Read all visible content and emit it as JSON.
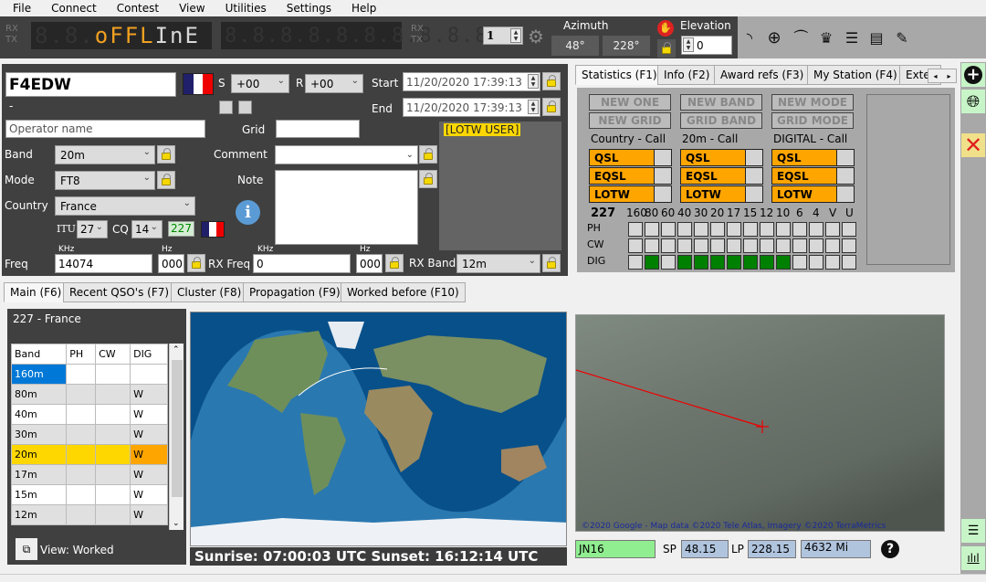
{
  "menu": [
    "File",
    "Connect",
    "Contest",
    "View",
    "Utilities",
    "Settings",
    "Help"
  ],
  "radio_display": {
    "rx_label": "RX",
    "tx_label": "TX",
    "status_text_orange": "oFFL",
    "status_text_white": "InE",
    "dim_left": "8.8.",
    "dim_right": "8.8.8.8.8.8.8.8.8.8."
  },
  "rotator": {
    "rig_number": "1",
    "azimuth_label": "Azimuth",
    "short_path": "48°",
    "long_path": "228°",
    "elevation_label": "Elevation",
    "elevation_value": "0"
  },
  "toolbar_icons": [
    "signal-icon",
    "globe-icon",
    "satellite-dish-icon",
    "crown-icon",
    "server-icon",
    "radio-icon",
    "microphone-icon"
  ],
  "qso": {
    "callsign": "F4EDW",
    "name_placeholder": "Operator name",
    "dash": "-",
    "rst_sent_label": "S",
    "rst_sent": "+00",
    "rst_rcvd_label": "R",
    "rst_rcvd": "+00",
    "start_label": "Start",
    "start_value": "11/20/2020 17:39:13",
    "end_label": "End",
    "end_value": "11/20/2020 17:39:13",
    "grid_label": "Grid",
    "grid_value": "",
    "band_label": "Band",
    "band_value": "20m",
    "mode_label": "Mode",
    "mode_value": "FT8",
    "country_label": "Country",
    "country_value": "France",
    "comment_label": "Comment",
    "comment_value": "",
    "note_label": "Note",
    "note_value": "",
    "itu_label": "ITU",
    "itu_value": "27",
    "cq_label": "CQ",
    "cq_value": "14",
    "dxcc": "227",
    "lotw_badge": "[LOTW USER]",
    "khz_label": "KHz",
    "hz_label": "Hz",
    "freq_label": "Freq",
    "freq_khz": "14074",
    "freq_hz": "000",
    "rxfreq_label": "RX Freq",
    "rxfreq_khz": "0",
    "rxfreq_hz": "000",
    "rxband_label": "RX Band",
    "rxband_value": "12m"
  },
  "stats_tabs": [
    "Statistics (F1)",
    "Info (F2)",
    "Award refs (F3)",
    "My Station (F4)",
    "Exte"
  ],
  "stats": {
    "new_buttons": [
      "NEW ONE",
      "NEW BAND",
      "NEW MODE",
      "NEW GRID",
      "GRID BAND",
      "GRID MODE"
    ],
    "columns": [
      "Country - Call",
      "20m - Call",
      "DIGITAL - Call"
    ],
    "qsl_labels": [
      "QSL",
      "EQSL",
      "LOTW"
    ],
    "dxcc": "227",
    "bands": [
      "160",
      "80",
      "60",
      "40",
      "30",
      "20",
      "17",
      "15",
      "12",
      "10",
      "6",
      "4",
      "V",
      "U"
    ],
    "modes": [
      "PH",
      "CW",
      "DIG"
    ],
    "worked": {
      "PH": [
        0,
        0,
        0,
        0,
        0,
        0,
        0,
        0,
        0,
        0,
        0,
        0,
        0,
        0
      ],
      "CW": [
        0,
        0,
        0,
        0,
        0,
        0,
        0,
        0,
        0,
        0,
        0,
        0,
        0,
        0
      ],
      "DIG": [
        0,
        1,
        0,
        1,
        1,
        1,
        1,
        1,
        1,
        1,
        0,
        0,
        0,
        0
      ]
    },
    "colors": {
      "worked": "#008000",
      "empty": "#d8d8d8",
      "qsl": "#ffa500"
    }
  },
  "main_tabs": [
    "Main (F6)",
    "Recent QSO's (F7)",
    "Cluster (F8)",
    "Propagation (F9)",
    "Worked before (F10)"
  ],
  "worked_panel": {
    "title": "227 - France",
    "headers": [
      "Band",
      "PH",
      "CW",
      "DIG"
    ],
    "rows": [
      {
        "band": "160m",
        "PH": "",
        "CW": "",
        "DIG": ""
      },
      {
        "band": "80m",
        "PH": "",
        "CW": "",
        "DIG": "W"
      },
      {
        "band": "40m",
        "PH": "",
        "CW": "",
        "DIG": "W"
      },
      {
        "band": "30m",
        "PH": "",
        "CW": "",
        "DIG": "W"
      },
      {
        "band": "20m",
        "PH": "",
        "CW": "",
        "DIG": "W"
      },
      {
        "band": "17m",
        "PH": "",
        "CW": "",
        "DIG": "W"
      },
      {
        "band": "15m",
        "PH": "",
        "CW": "",
        "DIG": "W"
      },
      {
        "band": "12m",
        "PH": "",
        "CW": "",
        "DIG": "W"
      }
    ],
    "view_label": "View:  Worked"
  },
  "sun": {
    "text": "Sunrise: 07:00:03 UTC  Sunset: 16:12:14 UTC"
  },
  "google_map": {
    "copyright": "©2020 Google - Map data ©2020 Tele Atlas, Imagery ©2020 TerraMetrics"
  },
  "path_info": {
    "locator": "JN16",
    "sp_label": "SP",
    "sp_value": "48.15",
    "lp_label": "LP",
    "lp_value": "228.15",
    "distance": "4632 Mi"
  }
}
